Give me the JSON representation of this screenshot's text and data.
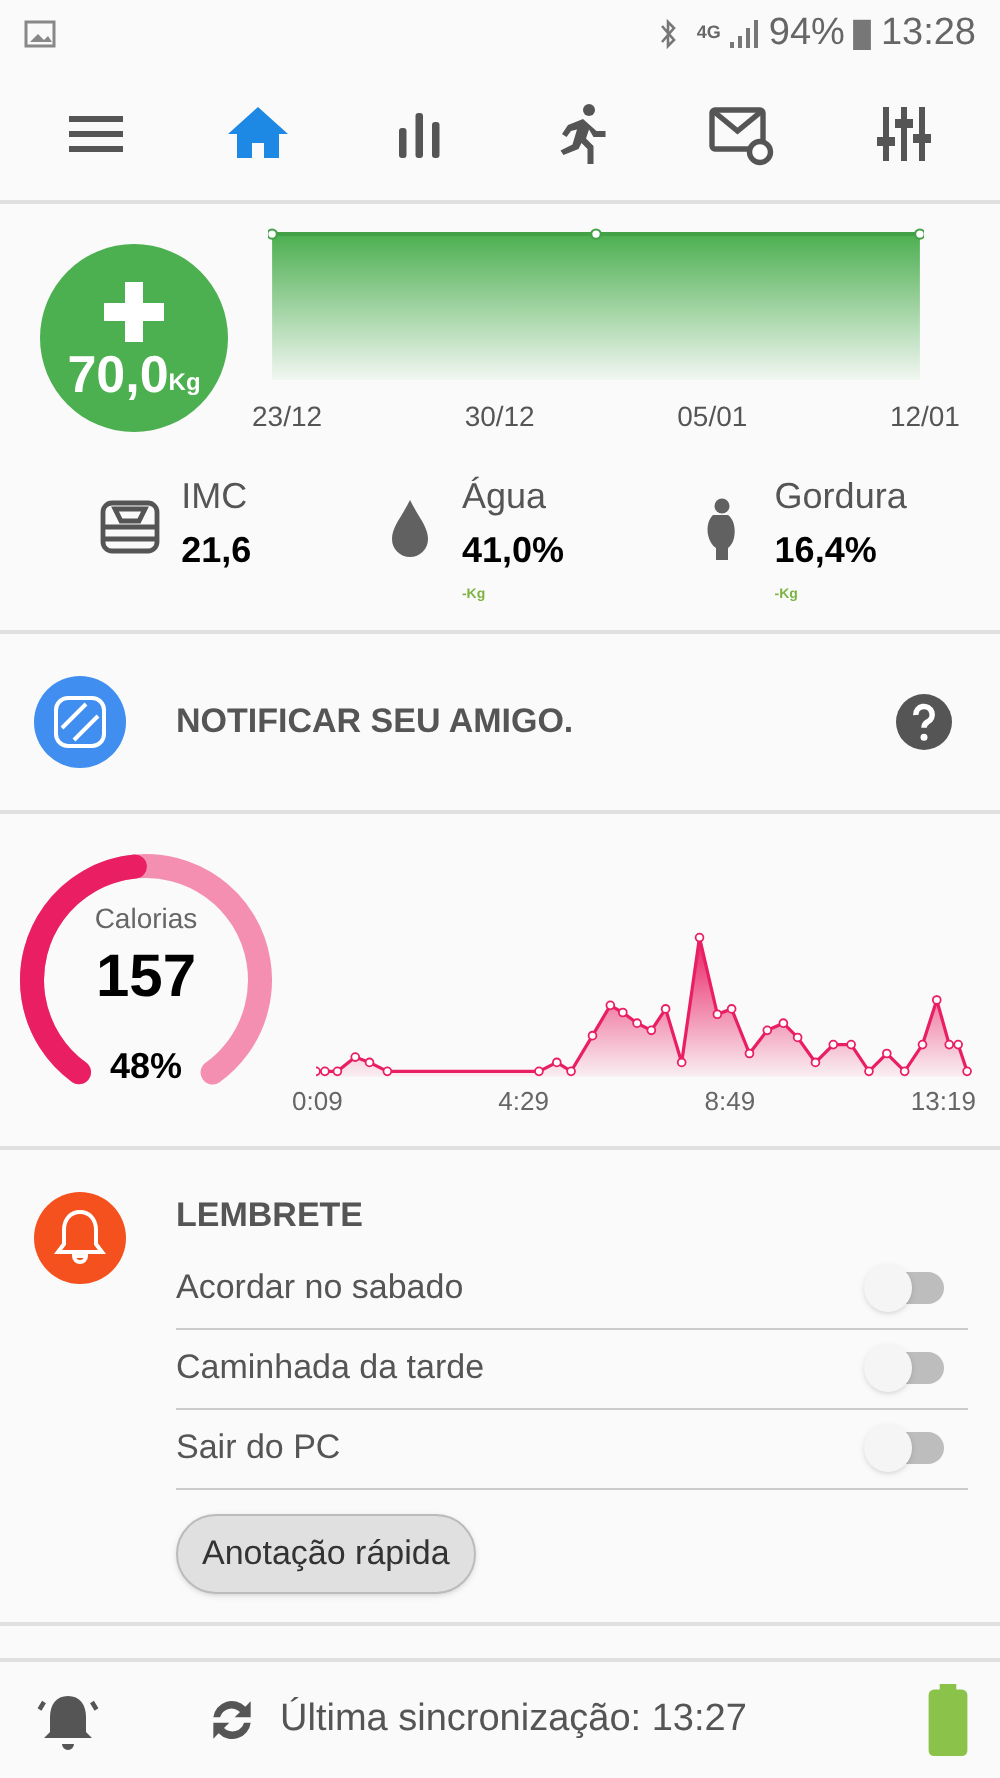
{
  "status_bar": {
    "network": "4G",
    "battery": "94%",
    "time": "13:28"
  },
  "nav": [
    {
      "kind": "menu",
      "selected": false
    },
    {
      "kind": "home",
      "selected": true
    },
    {
      "kind": "stats",
      "selected": false
    },
    {
      "kind": "activity",
      "selected": false
    },
    {
      "kind": "mail",
      "selected": false
    },
    {
      "kind": "settings",
      "selected": false
    }
  ],
  "weight": {
    "value": "70,0",
    "unit": "Kg",
    "dates": [
      "23/12",
      "30/12",
      "05/01",
      "12/01"
    ]
  },
  "metrics": [
    {
      "kind": "bmi",
      "label": "IMC",
      "value": "21,6"
    },
    {
      "kind": "water",
      "label": "Água",
      "value": "41,0%",
      "note": "-Kg"
    },
    {
      "kind": "fat",
      "label": "Gordura",
      "value": "16,4%",
      "note": "-Kg"
    }
  ],
  "notify": {
    "text": "NOTIFICAR SEU AMIGO."
  },
  "calories": {
    "label": "Calorias",
    "value": "157",
    "percent": "48%",
    "times": [
      "0:09",
      "4:29",
      "8:49",
      "13:19"
    ]
  },
  "reminder": {
    "title": "LEMBRETE",
    "items": [
      {
        "label": "Acordar no sabado",
        "on": false
      },
      {
        "label": "Caminhada da tarde",
        "on": false
      },
      {
        "label": "Sair do PC",
        "on": false
      }
    ],
    "button": "Anotação rápida"
  },
  "footer": {
    "sync": "Última sincronização: 13:27"
  }
}
